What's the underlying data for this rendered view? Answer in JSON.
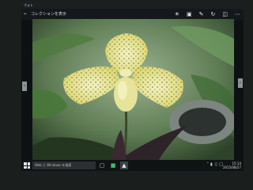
{
  "window": {
    "title": "フォト"
  },
  "commandbar": {
    "back_icon": "back-arrow-icon",
    "collection_label": "コレクションを表示",
    "icons": [
      "share-icon",
      "slideshow-icon",
      "edit-icon",
      "rotate-icon",
      "delete-icon",
      "more-icon"
    ]
  },
  "photo": {
    "subject": "orchid-photo"
  },
  "taskbar": {
    "search_placeholder": "Web と Windows を検索",
    "apps": [
      "task-view-icon",
      "store-icon",
      "photos-icon"
    ],
    "tray_icons": [
      "up-chevron-icon",
      "network-icon",
      "volume-icon",
      "notifications-icon"
    ],
    "time": "15:14",
    "date": "2015/08/27"
  },
  "colors": {
    "taskbar": "#101314",
    "titlebar": "#1b1f22",
    "accent": "#d9e7f2"
  }
}
